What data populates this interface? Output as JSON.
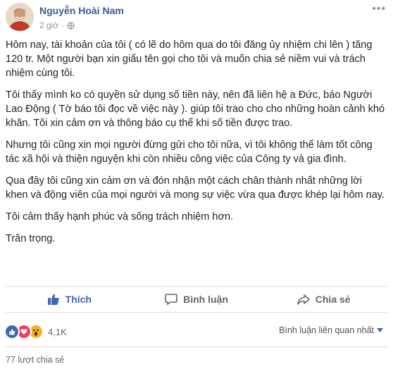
{
  "post": {
    "author": "Nguyễn Hoài Nam",
    "time": "2 giờ",
    "paragraphs": [
      "Hôm nay, tài khoản của tôi ( có lẽ do hôm qua do tôi đăng ủy nhiệm chi lên ) tăng 120 tr. Một người bạn xin giấu tên gọi cho tôi và muốn chia sẻ niềm vui và trách nhiệm cùng tôi.",
      "Tôi thấy mình ko có quyền sử dụng số tiền này, nên đã liên hệ a Đức, báo Người Lao Động ( Tờ báo tôi đọc về việc này ). giúp tôi trao cho cho những hoàn cảnh khó khăn. Tôi xin cảm ơn và thông báo cụ thể khi số tiền được trao.",
      "Nhưng tôi cũng xin mọi người đừng gửi cho tôi nữa, vì tôi không thể làm tốt công tác xã hội và thiện nguyện khi còn nhiều công việc của Công ty và gia đình.",
      "Qua đây tôi cũng xin cảm ơn và đón nhận một cách chân thành nhất những lời khen và động viên của mọi người và mong sự việc vừa qua được khép lại hôm nay.",
      "Tôi cảm thấy hạnh phúc và sống trách nhiệm hơn.",
      "Trân trọng."
    ]
  },
  "actions": {
    "like": "Thích",
    "comment": "Bình luận",
    "share": "Chia sẻ"
  },
  "stats": {
    "reaction_count": "4,1K",
    "sort_label": "Bình luận liên quan nhất",
    "shares": "77 lượt chia sẻ"
  },
  "colors": {
    "author": "#385898",
    "like_blue": "#4267b2",
    "love_red": "#f33e58",
    "wow_yellow": "#f7b125"
  },
  "icons": [
    "globe-icon",
    "like-thumb-icon",
    "comment-bubble-icon",
    "share-arrow-icon",
    "reaction-like-icon",
    "reaction-love-icon",
    "reaction-wow-icon",
    "caret-down-icon"
  ]
}
